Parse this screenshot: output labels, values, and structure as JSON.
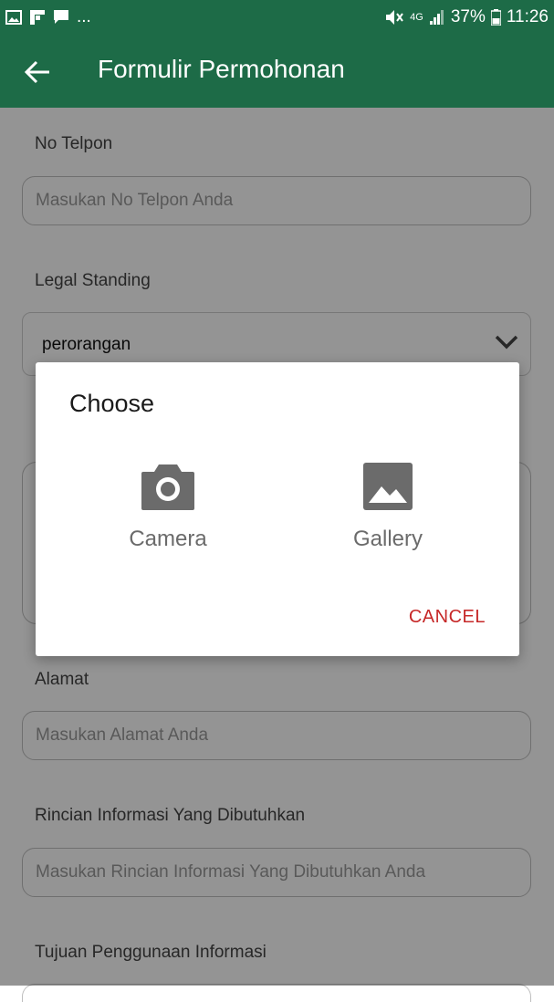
{
  "status_bar": {
    "left_icons": [
      "image-icon",
      "flipboard-icon",
      "chat-icon"
    ],
    "overflow": "...",
    "network": "4G",
    "battery": "37%",
    "time": "11:26"
  },
  "app_bar": {
    "title": "Formulir Permohonan"
  },
  "form": {
    "phone": {
      "label": "No Telpon",
      "placeholder": "Masukan No Telpon Anda"
    },
    "legal_standing": {
      "label": "Legal Standing",
      "value": "perorangan"
    },
    "address": {
      "label": "Alamat",
      "placeholder": "Masukan Alamat Anda"
    },
    "info_details": {
      "label": "Rincian Informasi Yang Dibutuhkan",
      "placeholder": "Masukan Rincian Informasi Yang Dibutuhkan Anda"
    },
    "purpose": {
      "label": "Tujuan Penggunaan Informasi"
    }
  },
  "dialog": {
    "title": "Choose",
    "options": [
      {
        "label": "Camera",
        "icon": "camera-icon"
      },
      {
        "label": "Gallery",
        "icon": "gallery-icon"
      }
    ],
    "cancel_label": "CANCEL"
  },
  "colors": {
    "app_bar": "#1d6b47",
    "cancel": "#c62828",
    "icon_gray": "#6b6b6b"
  }
}
